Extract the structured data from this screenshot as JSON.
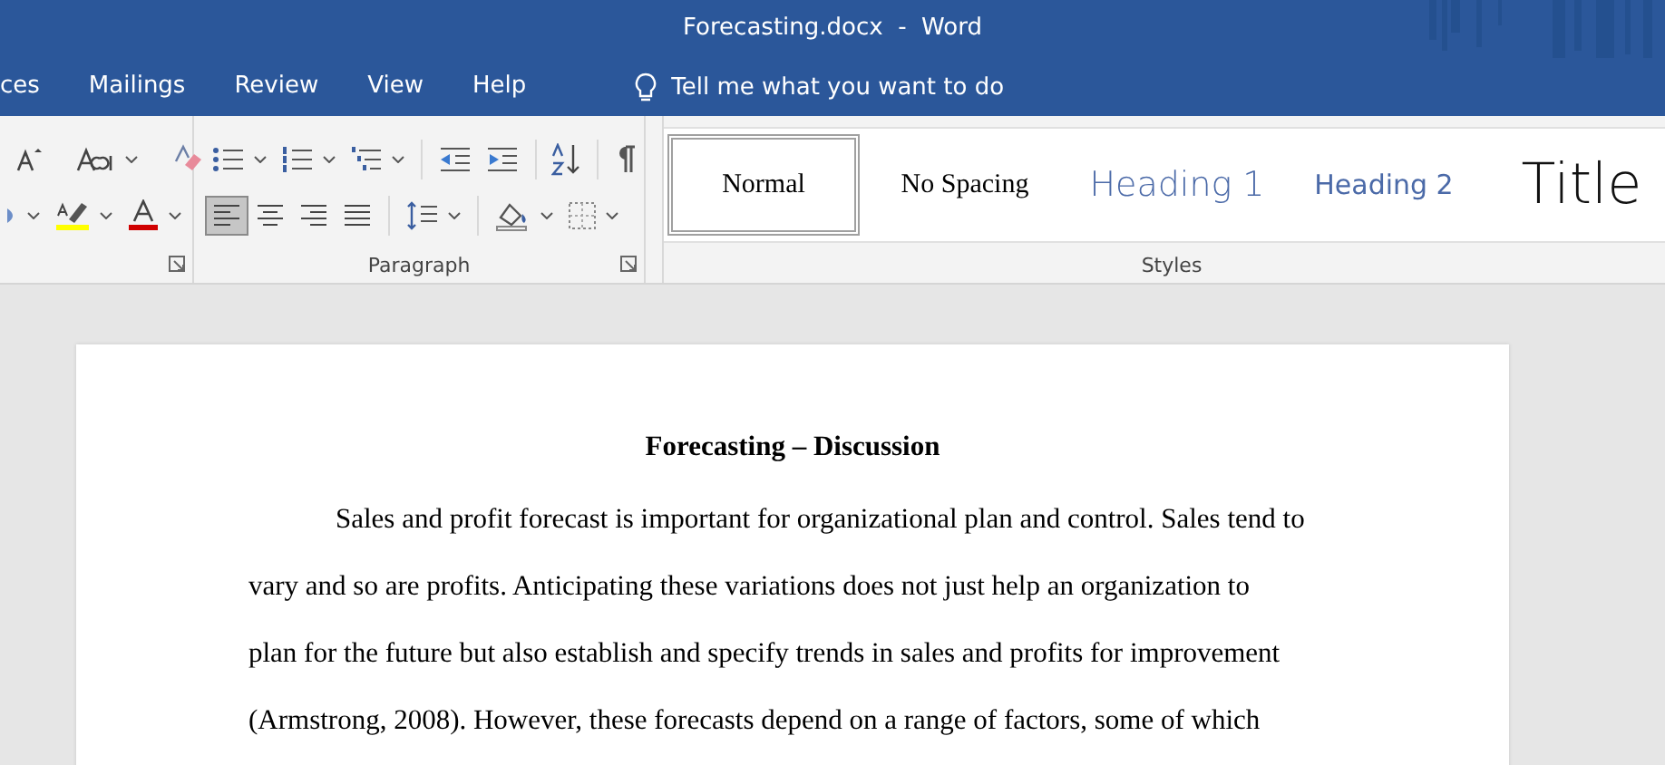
{
  "window": {
    "title": "Forecasting.docx  -  Word"
  },
  "tabs": [
    {
      "label": "ces",
      "selected": false
    },
    {
      "label": "Mailings",
      "selected": false
    },
    {
      "label": "Review",
      "selected": false
    },
    {
      "label": "View",
      "selected": false
    },
    {
      "label": "Help",
      "selected": false
    }
  ],
  "tell_me": {
    "placeholder": "Tell me what you want to do"
  },
  "ribbon": {
    "paragraph_group": {
      "label": "Paragraph",
      "alignment_buttons": [
        {
          "selected": true
        },
        {
          "selected": false
        },
        {
          "selected": false
        },
        {
          "selected": false
        }
      ]
    },
    "styles_group": {
      "label": "Styles",
      "styles": [
        {
          "name": "Normal",
          "kind": "normal",
          "selected": true
        },
        {
          "name": "No Spacing",
          "kind": "normal",
          "selected": false
        },
        {
          "name": "Heading 1",
          "kind": "heading1",
          "selected": false
        },
        {
          "name": "Heading 2",
          "kind": "heading2",
          "selected": false
        },
        {
          "name": "Title",
          "kind": "title",
          "selected": false
        }
      ]
    }
  },
  "document": {
    "heading": "Forecasting – Discussion",
    "paragraph_lines": [
      "Sales and profit forecast is important for organizational plan and control. Sales tend to",
      "vary and so are profits. Anticipating these variations does not just help an organization to",
      "plan for the future but also establish and specify trends in sales and profits for improvement",
      "(Armstrong, 2008). However, these forecasts depend on a range of factors, some of which"
    ]
  }
}
